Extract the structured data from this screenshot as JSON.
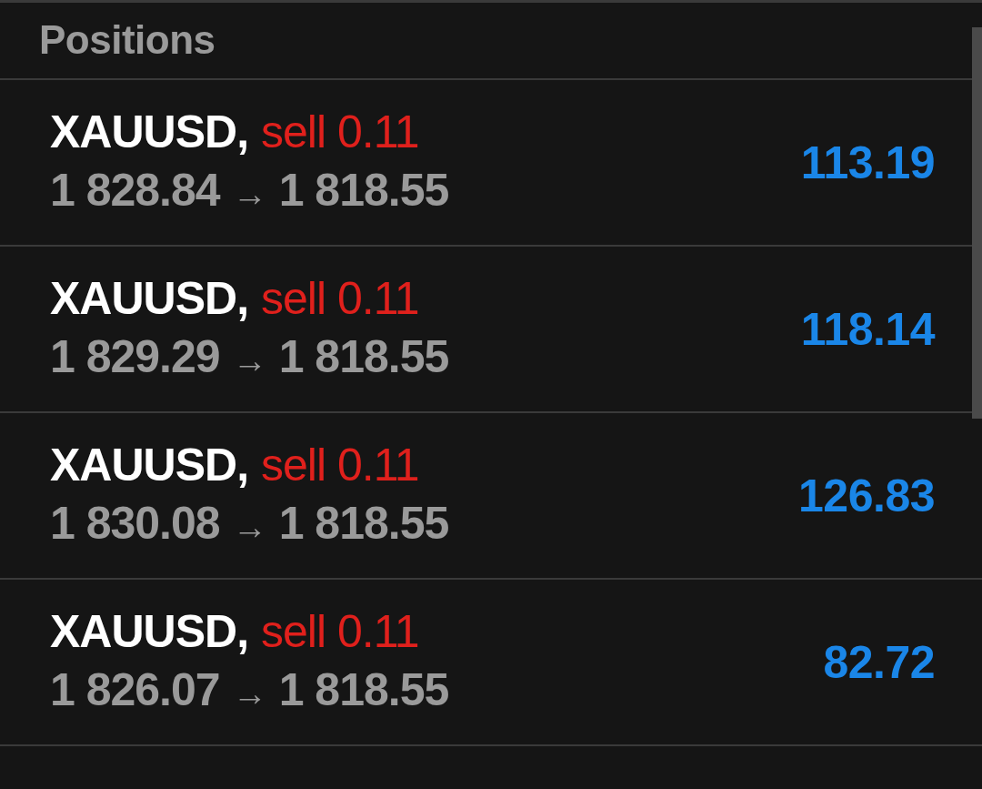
{
  "header": {
    "title": "Positions"
  },
  "positions": [
    {
      "symbol": "XAUUSD,",
      "side": "sell 0.11",
      "open_price": "1 828.84",
      "arrow": "→",
      "current_price": "1 818.55",
      "profit": "113.19"
    },
    {
      "symbol": "XAUUSD,",
      "side": "sell 0.11",
      "open_price": "1 829.29",
      "arrow": "→",
      "current_price": "1 818.55",
      "profit": "118.14"
    },
    {
      "symbol": "XAUUSD,",
      "side": "sell 0.11",
      "open_price": "1 830.08",
      "arrow": "→",
      "current_price": "1 818.55",
      "profit": "126.83"
    },
    {
      "symbol": "XAUUSD,",
      "side": "sell 0.11",
      "open_price": "1 826.07",
      "arrow": "→",
      "current_price": "1 818.55",
      "profit": "82.72"
    }
  ]
}
